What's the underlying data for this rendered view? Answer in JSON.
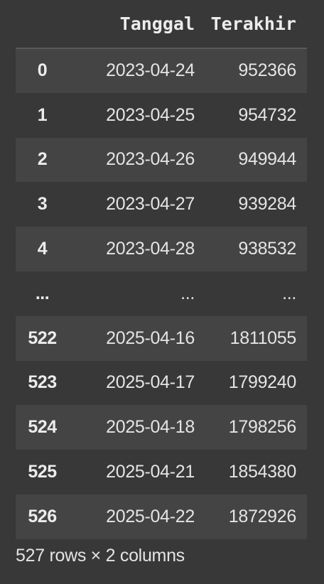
{
  "dataframe": {
    "columns": [
      "",
      "Tanggal",
      "Terakhir"
    ],
    "rows": [
      {
        "index": "0",
        "tanggal": "2023-04-24",
        "terakhir": "952366"
      },
      {
        "index": "1",
        "tanggal": "2023-04-25",
        "terakhir": "954732"
      },
      {
        "index": "2",
        "tanggal": "2023-04-26",
        "terakhir": "949944"
      },
      {
        "index": "3",
        "tanggal": "2023-04-27",
        "terakhir": "939284"
      },
      {
        "index": "4",
        "tanggal": "2023-04-28",
        "terakhir": "938532"
      },
      {
        "index": "...",
        "tanggal": "...",
        "terakhir": "..."
      },
      {
        "index": "522",
        "tanggal": "2025-04-16",
        "terakhir": "1811055"
      },
      {
        "index": "523",
        "tanggal": "2025-04-17",
        "terakhir": "1799240"
      },
      {
        "index": "524",
        "tanggal": "2025-04-18",
        "terakhir": "1798256"
      },
      {
        "index": "525",
        "tanggal": "2025-04-21",
        "terakhir": "1854380"
      },
      {
        "index": "526",
        "tanggal": "2025-04-22",
        "terakhir": "1872926"
      }
    ],
    "shape_text": "527 rows × 2 columns"
  },
  "colors": {
    "background": "#383838",
    "row_alt": "#444444",
    "text": "#e4e4e4",
    "header_rule": "#5a5a5a"
  }
}
